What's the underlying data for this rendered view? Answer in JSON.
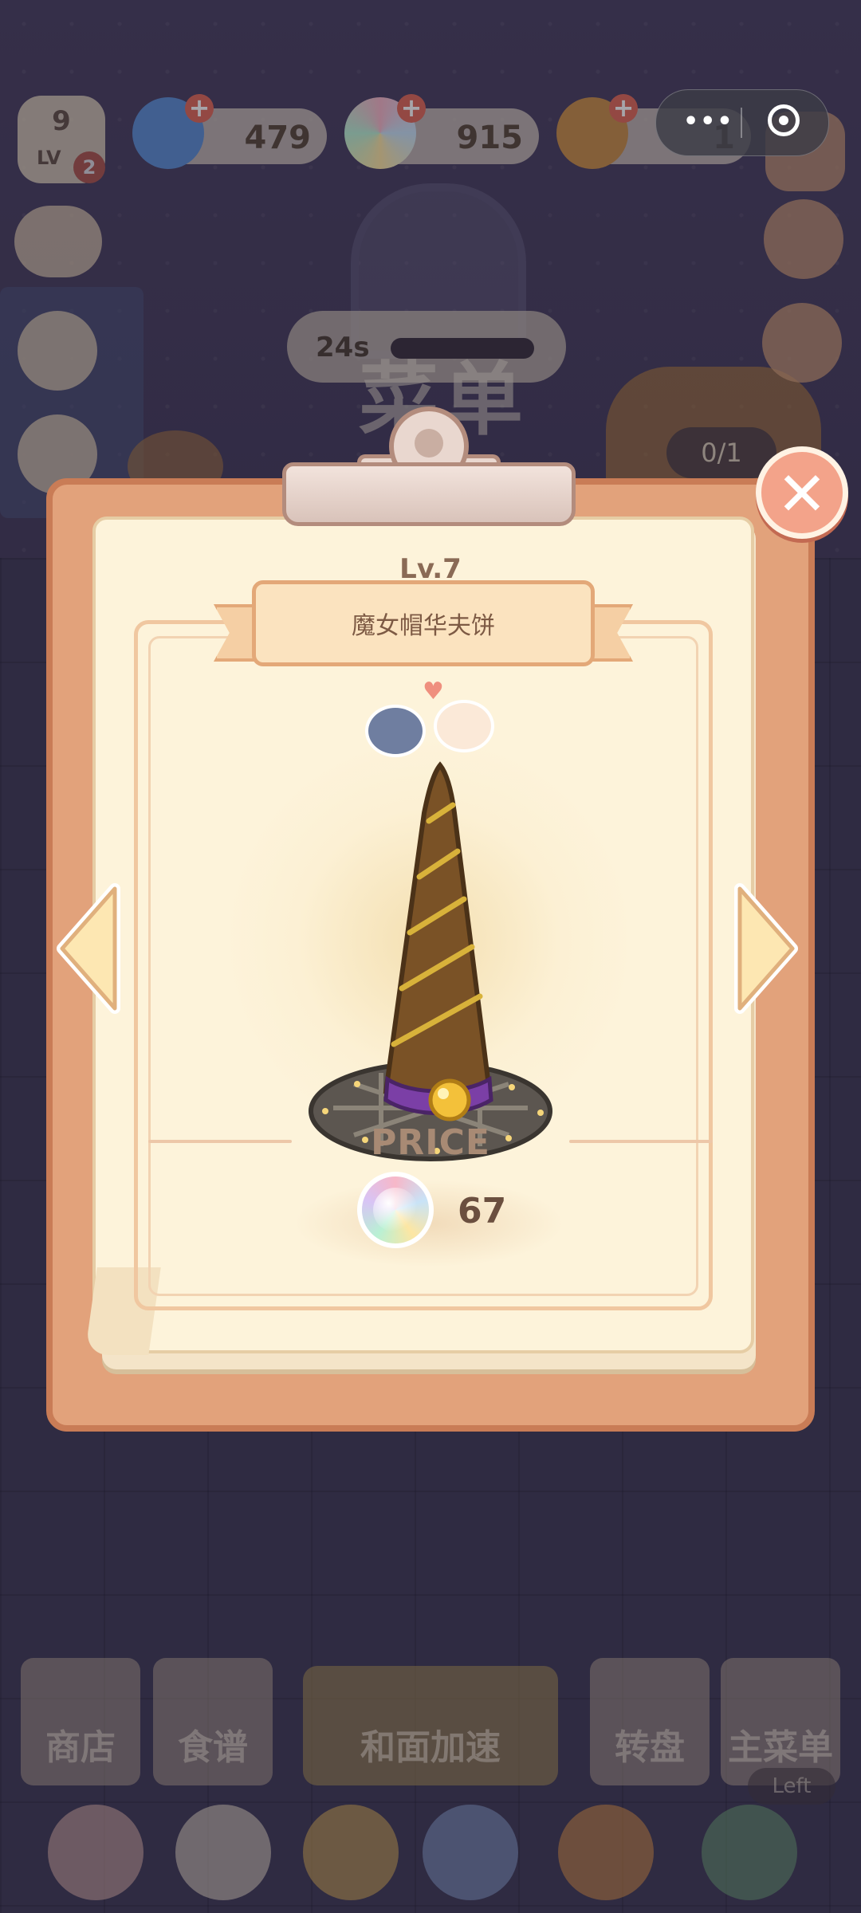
{
  "hud": {
    "player_level": "9",
    "lv_label": "LV",
    "lv_badge": "2",
    "gems": "479",
    "orbs": "915",
    "tickets": "1"
  },
  "capsule": {
    "more_label": "•••"
  },
  "scene": {
    "timer": "24s",
    "menu_title": "菜单",
    "order_progress": "0/1"
  },
  "recipe_card": {
    "level": "Lv.7",
    "name": "魔女帽华夫饼",
    "price_label": "PRICE",
    "price_value": "67",
    "close_symbol": "✕"
  },
  "bottom_nav": {
    "shop": "商店",
    "recipes": "食谱",
    "knead_speedup": "和面加速",
    "wheel": "转盘",
    "main_menu": "主菜单",
    "left_tag": "Left"
  },
  "colors": {
    "board": "#e2a27b",
    "paper": "#fdf3da",
    "close": "#f3a38a",
    "hat_brown": "#7a5226",
    "hat_gold": "#d8b23a",
    "band_purple": "#7b3fa6"
  }
}
